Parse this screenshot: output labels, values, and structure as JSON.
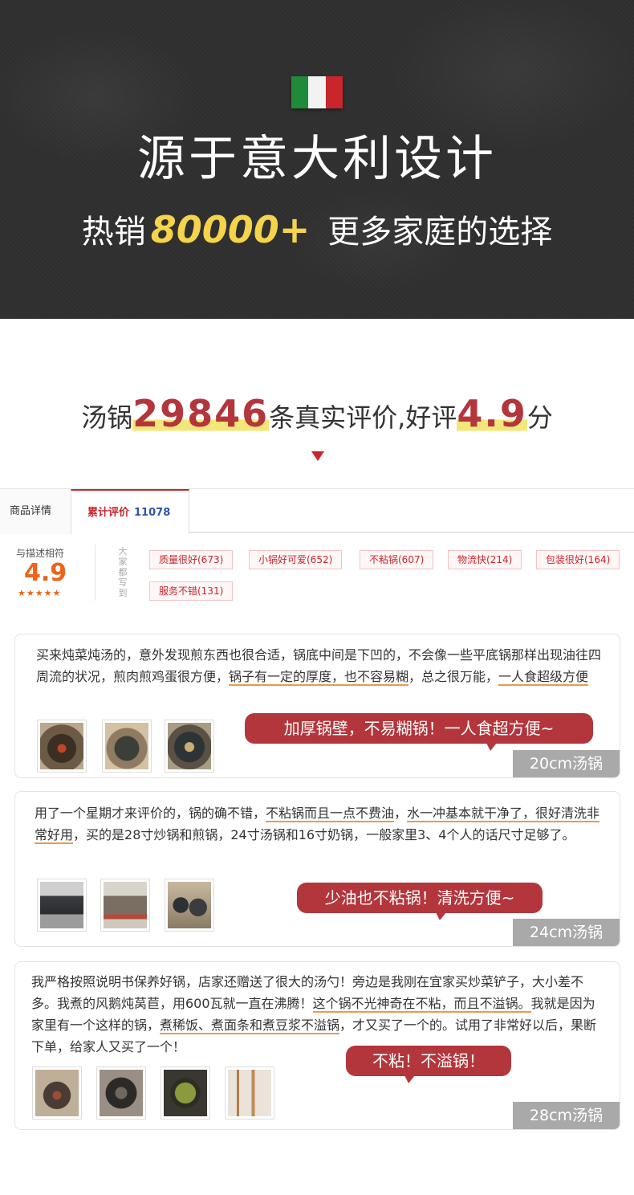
{
  "hero": {
    "title": "源于意大利设计",
    "sub_prefix": "热销",
    "sub_number": "80000+",
    "sub_suffix": "更多家庭的选择"
  },
  "headline": {
    "p1": "汤锅",
    "count": "29846",
    "p2": "条真实评价,好评",
    "rating": "4.9",
    "p3": "分"
  },
  "tabs": {
    "detail": "商品详情",
    "reviews": "累计评价",
    "reviews_count": "11078"
  },
  "summary": {
    "label": "与描述相符",
    "score": "4.9",
    "stars": "★★★★★",
    "vertical_text": "大家都写到",
    "tags": [
      "质量很好(673)",
      "小锅好可爱(652)",
      "不粘锅(607)",
      "物流快(214)",
      "包装很好(164)",
      "服务不错(131)"
    ]
  },
  "reviews": [
    {
      "text_a": "买来炖菜炖汤的，意外发现煎东西也很合适，锅底中间是下凹的，不会像一些平底锅那样出现油往四周流的状况，煎肉煎鸡蛋很方便，",
      "hl_1": "锅子有一定的厚度，也不容易糊",
      "text_b": "，总之很万能，",
      "hl_2": "一人食超级方便",
      "bubble": "加厚锅壁，不易糊锅！一人食超方便~",
      "size": "20cm汤锅"
    },
    {
      "text_a": "用了一个星期才来评价的，锅的确不错，",
      "hl_1": "不粘锅而且一点不费油",
      "text_b": "，",
      "hl_2": "水一冲基本就干净了，很好清洗非常好用",
      "text_c": "，买的是28寸炒锅和煎锅，24寸汤锅和16寸奶锅，一般家里3、4个人的话尺寸足够了。",
      "bubble": "少油也不粘锅！清洗方便~",
      "size": "24cm汤锅"
    },
    {
      "text_a": "我严格按照说明书保养好锅，店家还赠送了很大的汤勺！旁边是我刚在宜家买炒菜铲子，大小差不多。我煮的风鹅炖莴苣，用600瓦就一直在沸腾！",
      "hl_1": "这个锅不光神奇在不粘，而且不溢锅。",
      "text_b": "我就是因为家里有一个这样的锅，",
      "hl_2": "煮稀饭、煮面条和煮豆浆不溢锅",
      "text_c": "，才又买了一个的。试用了非常好以后，果断下单，给家人又买了一个！",
      "bubble": "不粘！不溢锅！",
      "size": "28cm汤锅"
    }
  ]
}
